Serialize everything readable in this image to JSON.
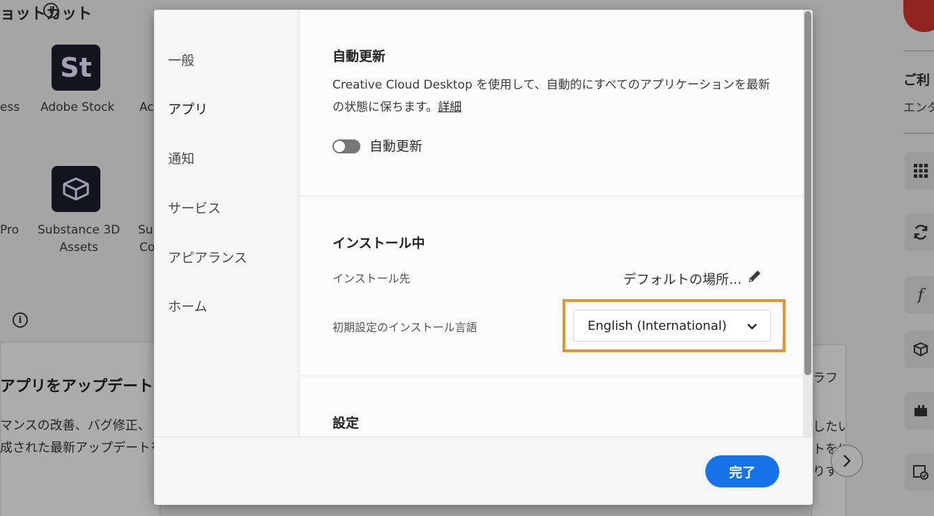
{
  "background": {
    "shortcut_heading": "ョットカット",
    "apps": [
      {
        "label": "ess"
      },
      {
        "label": "Adobe Stock",
        "tile": "St"
      },
      {
        "label": "Ac"
      },
      {
        "label": "Pro"
      },
      {
        "label": "Substance 3D\nAssets"
      },
      {
        "label": "Sul\nCo"
      }
    ],
    "update_card": {
      "title": "アプリをアップデート",
      "line1": "マンスの改善、バグ修正、",
      "line2": "成された最新アップデートを"
    },
    "right_card": {
      "lines": [
        "ラフ",
        "したい",
        "トをに",
        "りす"
      ]
    },
    "rail": {
      "title": "ご利",
      "subtitle": "エンタ"
    },
    "colors": {
      "avatar": "#d0342c"
    }
  },
  "dialog": {
    "nav": {
      "items": [
        {
          "label": "一般"
        },
        {
          "label": "アプリ",
          "active": true
        },
        {
          "label": "通知"
        },
        {
          "label": "サービス"
        },
        {
          "label": "アピアランス"
        },
        {
          "label": "ホーム"
        }
      ]
    },
    "auto_update": {
      "title": "自動更新",
      "description": "Creative Cloud Desktop を使用して、自動的にすべてのアプリケーションを最新の状態に保ちます。",
      "link": "詳細",
      "toggle_label": "自動更新",
      "toggle_on": false
    },
    "installing": {
      "title": "インストール中",
      "location_label": "インストール先",
      "location_value": "デフォルトの場所...",
      "language_label": "初期設定のインストール言語",
      "language_value": "English (International)"
    },
    "settings": {
      "title": "設定"
    },
    "done_label": "完了"
  },
  "colors": {
    "primary_button": "#1473e6",
    "highlight": "#e6952e",
    "toggle_off": "#767676"
  }
}
